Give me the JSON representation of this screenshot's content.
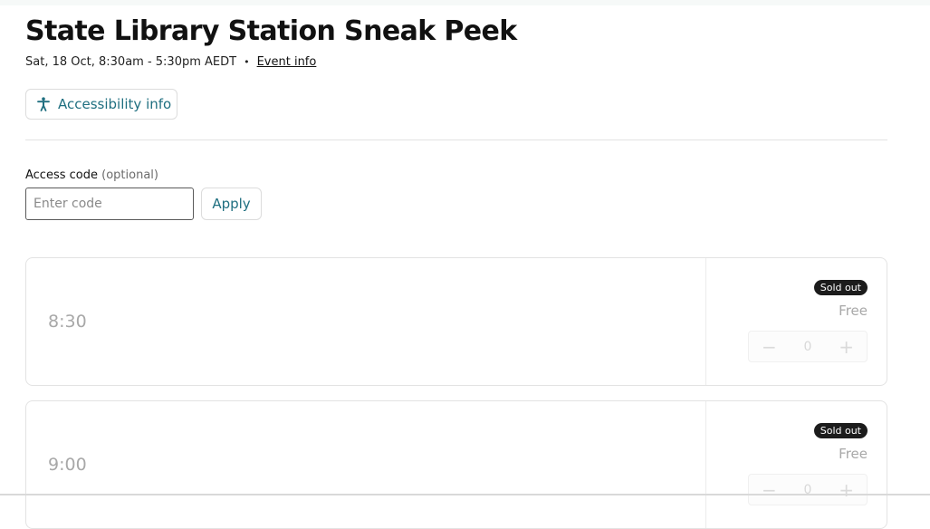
{
  "event": {
    "title": "State Library Station Sneak Peek",
    "datetime": "Sat, 18 Oct, 8:30am - 5:30pm AEDT",
    "separator": "•",
    "event_info_link": "Event info"
  },
  "accessibility": {
    "label": "Accessibility info",
    "icon": "person-accessibility-icon"
  },
  "access_code": {
    "label": "Access code",
    "optional_label": "(optional)",
    "placeholder": "Enter code",
    "value": "",
    "apply_label": "Apply"
  },
  "tickets": [
    {
      "time": "8:30",
      "badge": "Sold out",
      "price": "Free",
      "quantity": "0",
      "minus": "−",
      "plus": "+"
    },
    {
      "time": "9:00",
      "badge": "Sold out",
      "price": "Free",
      "quantity": "0",
      "minus": "−",
      "plus": "+"
    }
  ],
  "colors": {
    "accent": "#1f6f80",
    "badge_bg": "#1c1c1c",
    "muted_text": "#a8a8a8"
  }
}
